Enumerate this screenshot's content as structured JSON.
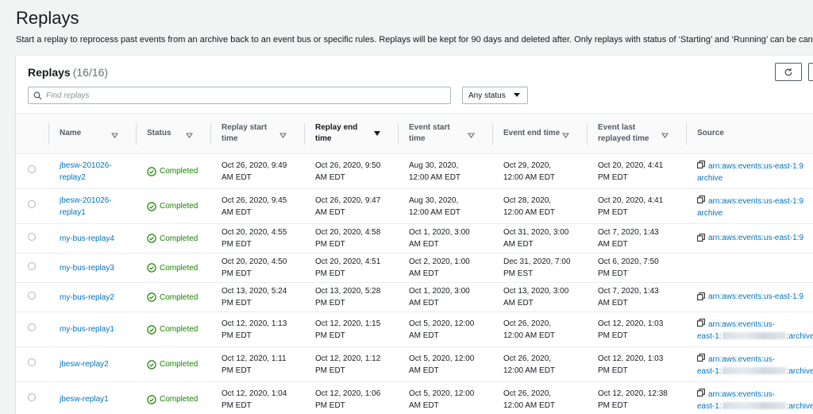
{
  "page": {
    "title": "Replays",
    "description": "Start a replay to reprocess past events from an archive back to an event bus or specific rules. Replays will be kept for 90 days and deleted after. Only replays with status of ‘Starting’ and ‘Running’ can be cancelled."
  },
  "panel": {
    "title": "Replays",
    "count": "(16/16)",
    "search_placeholder": "Find replays",
    "status_filter": "Any status"
  },
  "columns": [
    {
      "l1": "Name",
      "l2": ""
    },
    {
      "l1": "Status",
      "l2": ""
    },
    {
      "l1": "Replay start",
      "l2": "time"
    },
    {
      "l1": "Replay end",
      "l2": "time"
    },
    {
      "l1": "Event start time",
      "l2": ""
    },
    {
      "l1": "Event end time",
      "l2": ""
    },
    {
      "l1": "Event last",
      "l2": "replayed time"
    },
    {
      "l1": "Source",
      "l2": ""
    }
  ],
  "rows": [
    {
      "name": [
        "jbesw-201026-",
        "replay2"
      ],
      "status": "Completed",
      "rs": [
        "Oct 26, 2020, 9:49",
        "AM EDT"
      ],
      "re": [
        "Oct 26, 2020, 9:50",
        "AM EDT"
      ],
      "es": [
        "Aug 30, 2020,",
        "12:00 AM EDT"
      ],
      "ee": [
        "Oct 29, 2020,",
        "12:00 AM EDT"
      ],
      "lr": [
        "Oct 20, 2020, 4:41",
        "PM EDT"
      ],
      "src": [
        "arn:aws:events:us-east-1:9",
        "archive"
      ]
    },
    {
      "name": [
        "jbesw-201026-",
        "replay1"
      ],
      "status": "Completed",
      "rs": [
        "Oct 26, 2020, 9:45",
        "AM EDT"
      ],
      "re": [
        "Oct 26, 2020, 9:47",
        "AM EDT"
      ],
      "es": [
        "Aug 30, 2020,",
        "12:00 AM EDT"
      ],
      "ee": [
        "Oct 28, 2020,",
        "12:00 AM EDT"
      ],
      "lr": [
        "Oct 20, 2020, 4:41",
        "PM EDT"
      ],
      "src": [
        "arn:aws:events:us-east-1:9",
        "archive"
      ]
    },
    {
      "name": [
        "my-bus-replay4",
        ""
      ],
      "status": "Completed",
      "rs": [
        "Oct 20, 2020, 4:55",
        "PM EDT"
      ],
      "re": [
        "Oct 20, 2020, 4:58",
        "PM EDT"
      ],
      "es": [
        "Oct 1, 2020, 3:00",
        "AM EDT"
      ],
      "ee": [
        "Oct 31, 2020, 3:00",
        "AM EDT"
      ],
      "lr": [
        "Oct 7, 2020, 1:43",
        "AM EDT"
      ],
      "src": [
        "arn:aws:events:us-east-1:9",
        ""
      ]
    },
    {
      "name": [
        "my-bus-replay3",
        ""
      ],
      "status": "Completed",
      "rs": [
        "Oct 20, 2020, 4:50",
        "PM EDT"
      ],
      "re": [
        "Oct 20, 2020, 4:51",
        "PM EDT"
      ],
      "es": [
        "Oct 2, 2020, 1:00",
        "AM EDT"
      ],
      "ee": [
        "Dec 31, 2020, 7:00",
        "PM EST"
      ],
      "lr": [
        "Oct 6, 2020, 7:50",
        "PM EDT"
      ],
      "src": [
        "",
        ""
      ]
    },
    {
      "name": [
        "my-bus-replay2",
        ""
      ],
      "status": "Completed",
      "rs": [
        "Oct 13, 2020, 5:24",
        "PM EDT"
      ],
      "re": [
        "Oct 13, 2020, 5:28",
        "PM EDT"
      ],
      "es": [
        "Oct 1, 2020, 3:00",
        "AM EDT"
      ],
      "ee": [
        "Oct 13, 2020, 3:00",
        "AM EDT"
      ],
      "lr": [
        "Oct 7, 2020, 1:43",
        "AM EDT"
      ],
      "src": [
        "arn:aws:events:us-east-1:9",
        ""
      ]
    },
    {
      "name": [
        "my-bus-replay1",
        ""
      ],
      "status": "Completed",
      "rs": [
        "Oct 12, 2020, 1:13",
        "PM EDT"
      ],
      "re": [
        "Oct 12, 2020, 1:15",
        "PM EDT"
      ],
      "es": [
        "Oct 5, 2020, 12:00",
        "AM EDT"
      ],
      "ee": [
        "Oct 26, 2020,",
        "12:00 AM EDT"
      ],
      "lr": [
        "Oct 12, 2020, 1:03",
        "PM EDT"
      ],
      "src": [
        "arn:aws:events:us-",
        "east-1:"
      ],
      "src_tail": ":archive/"
    },
    {
      "name": [
        "jbesw-replay2",
        ""
      ],
      "status": "Completed",
      "rs": [
        "Oct 12, 2020, 1:11",
        "PM EDT"
      ],
      "re": [
        "Oct 12, 2020, 1:12",
        "PM EDT"
      ],
      "es": [
        "Oct 5, 2020, 12:00",
        "AM EDT"
      ],
      "ee": [
        "Oct 26, 2020,",
        "12:00 AM EDT"
      ],
      "lr": [
        "Oct 12, 2020, 1:03",
        "PM EDT"
      ],
      "src": [
        "arn:aws:events:us-",
        "east-1:"
      ],
      "src_tail": ":archive/"
    },
    {
      "name": [
        "jbesw-replay1",
        ""
      ],
      "status": "Completed",
      "rs": [
        "Oct 12, 2020, 1:04",
        "PM EDT"
      ],
      "re": [
        "Oct 12, 2020, 1:06",
        "PM EDT"
      ],
      "es": [
        "Oct 5, 2020, 12:00",
        "AM EDT"
      ],
      "ee": [
        "Oct 26, 2020,",
        "12:00 AM EDT"
      ],
      "lr": [
        "Oct 12, 2020, 12:38",
        "PM EDT"
      ],
      "src": [
        "arn:aws:events:us-",
        "east-1:"
      ],
      "src_tail": ":archive/"
    }
  ],
  "colors": {
    "link": "#0073bb",
    "success": "#1d8102"
  }
}
